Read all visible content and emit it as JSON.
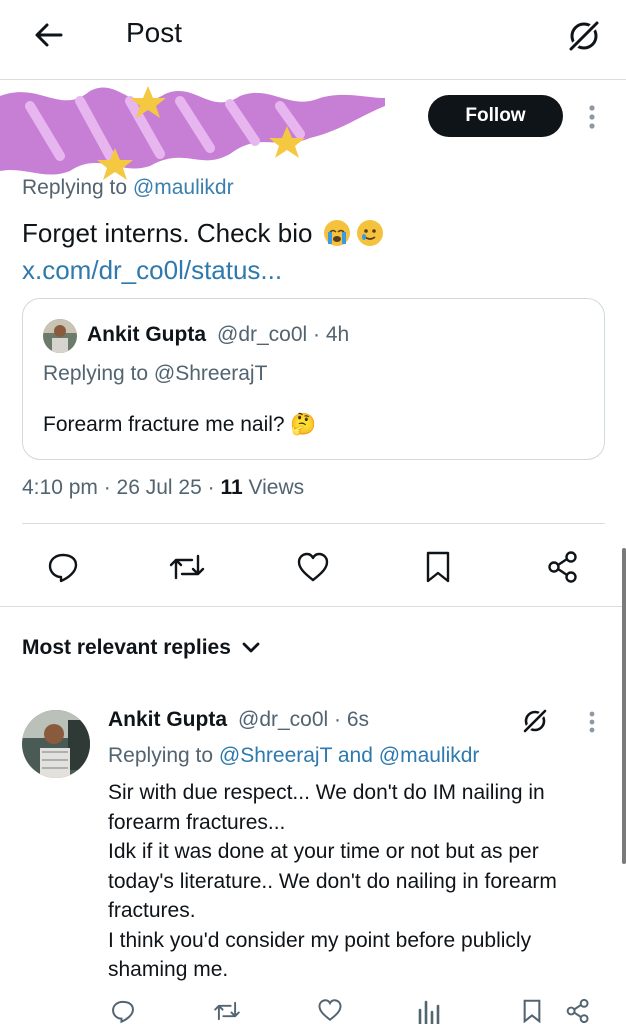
{
  "header": {
    "title": "Post"
  },
  "post": {
    "follow_label": "Follow",
    "replying_prefix": "Replying to",
    "replying_mention": "@maulikdr",
    "text": "Forget interns. Check bio",
    "link": "x.com/dr_co0l/status...",
    "meta_time": "4:10 pm · 26 Jul 25 · ",
    "meta_views_count": "11",
    "meta_views_label": " Views"
  },
  "quote": {
    "name": "Ankit Gupta",
    "handle": "@dr_co0l · 4h",
    "replying": "Replying to @ShreerajT",
    "text": "Forearm fracture me nail? 🤔"
  },
  "replies_sort": {
    "label": "Most relevant replies"
  },
  "reply": {
    "name": "Ankit Gupta",
    "handle": "@dr_co0l · 6s",
    "replying_prefix": "Replying to ",
    "replying_mentions": "@ShreerajT and @maulikdr",
    "lines": [
      "Sir with due respect... We don't do IM nailing in",
      "forearm fractures...",
      "Idk if it was done at your time or not but as per",
      "today's literature.. We don't do nailing in forearm",
      "fractures.",
      "I think you'd consider my point before publicly",
      "shaming me."
    ]
  },
  "icons": {
    "back": "back-arrow-icon",
    "grok": "grok-icon",
    "reply": "reply-icon",
    "repost": "repost-icon",
    "like": "like-icon",
    "bookmark": "bookmark-icon",
    "share": "share-icon",
    "views": "views-icon",
    "more": "more-vertical-icon",
    "chevron": "chevron-down-icon"
  },
  "colors": {
    "text": "#0f1419",
    "secondary": "#536471",
    "link": "#2e79ad",
    "follow_bg": "#0f1419",
    "scribble": "#c77fd6",
    "star": "#f5c842"
  }
}
